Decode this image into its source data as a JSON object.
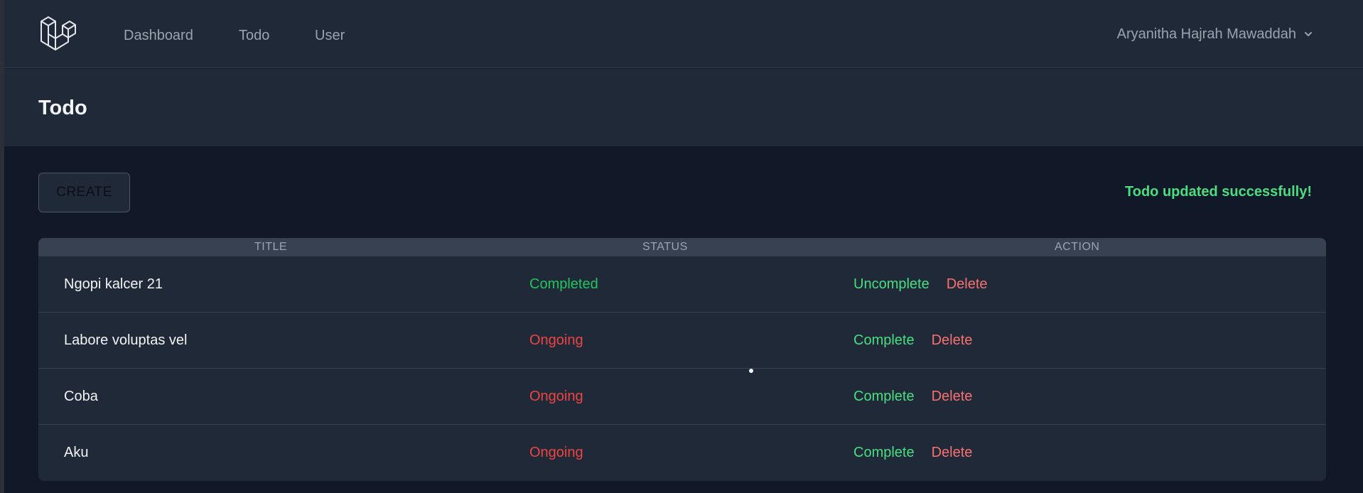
{
  "nav": {
    "links": [
      "Dashboard",
      "Todo",
      "User"
    ],
    "user_name": "Aryanitha Hajrah Mawaddah"
  },
  "header": {
    "title": "Todo"
  },
  "toolbar": {
    "create_label": "CREATE",
    "flash_message": "Todo updated successfully!"
  },
  "table": {
    "columns": [
      "TITLE",
      "STATUS",
      "ACTION"
    ],
    "rows": [
      {
        "title": "Ngopi kalcer 21",
        "status": "Completed",
        "toggle": "Uncomplete",
        "delete": "Delete"
      },
      {
        "title": "Labore voluptas vel",
        "status": "Ongoing",
        "toggle": "Complete",
        "delete": "Delete"
      },
      {
        "title": "Coba",
        "status": "Ongoing",
        "toggle": "Complete",
        "delete": "Delete"
      },
      {
        "title": "Aku",
        "status": "Ongoing",
        "toggle": "Complete",
        "delete": "Delete"
      }
    ]
  },
  "colors": {
    "background": "#111827",
    "surface": "#1f2937",
    "table_header": "#374151",
    "success": "#4ade80",
    "completed": "#22c55e",
    "danger": "#ef4444"
  },
  "icons": {
    "logo": "laravel-logo-icon",
    "dropdown": "chevron-down-icon"
  }
}
